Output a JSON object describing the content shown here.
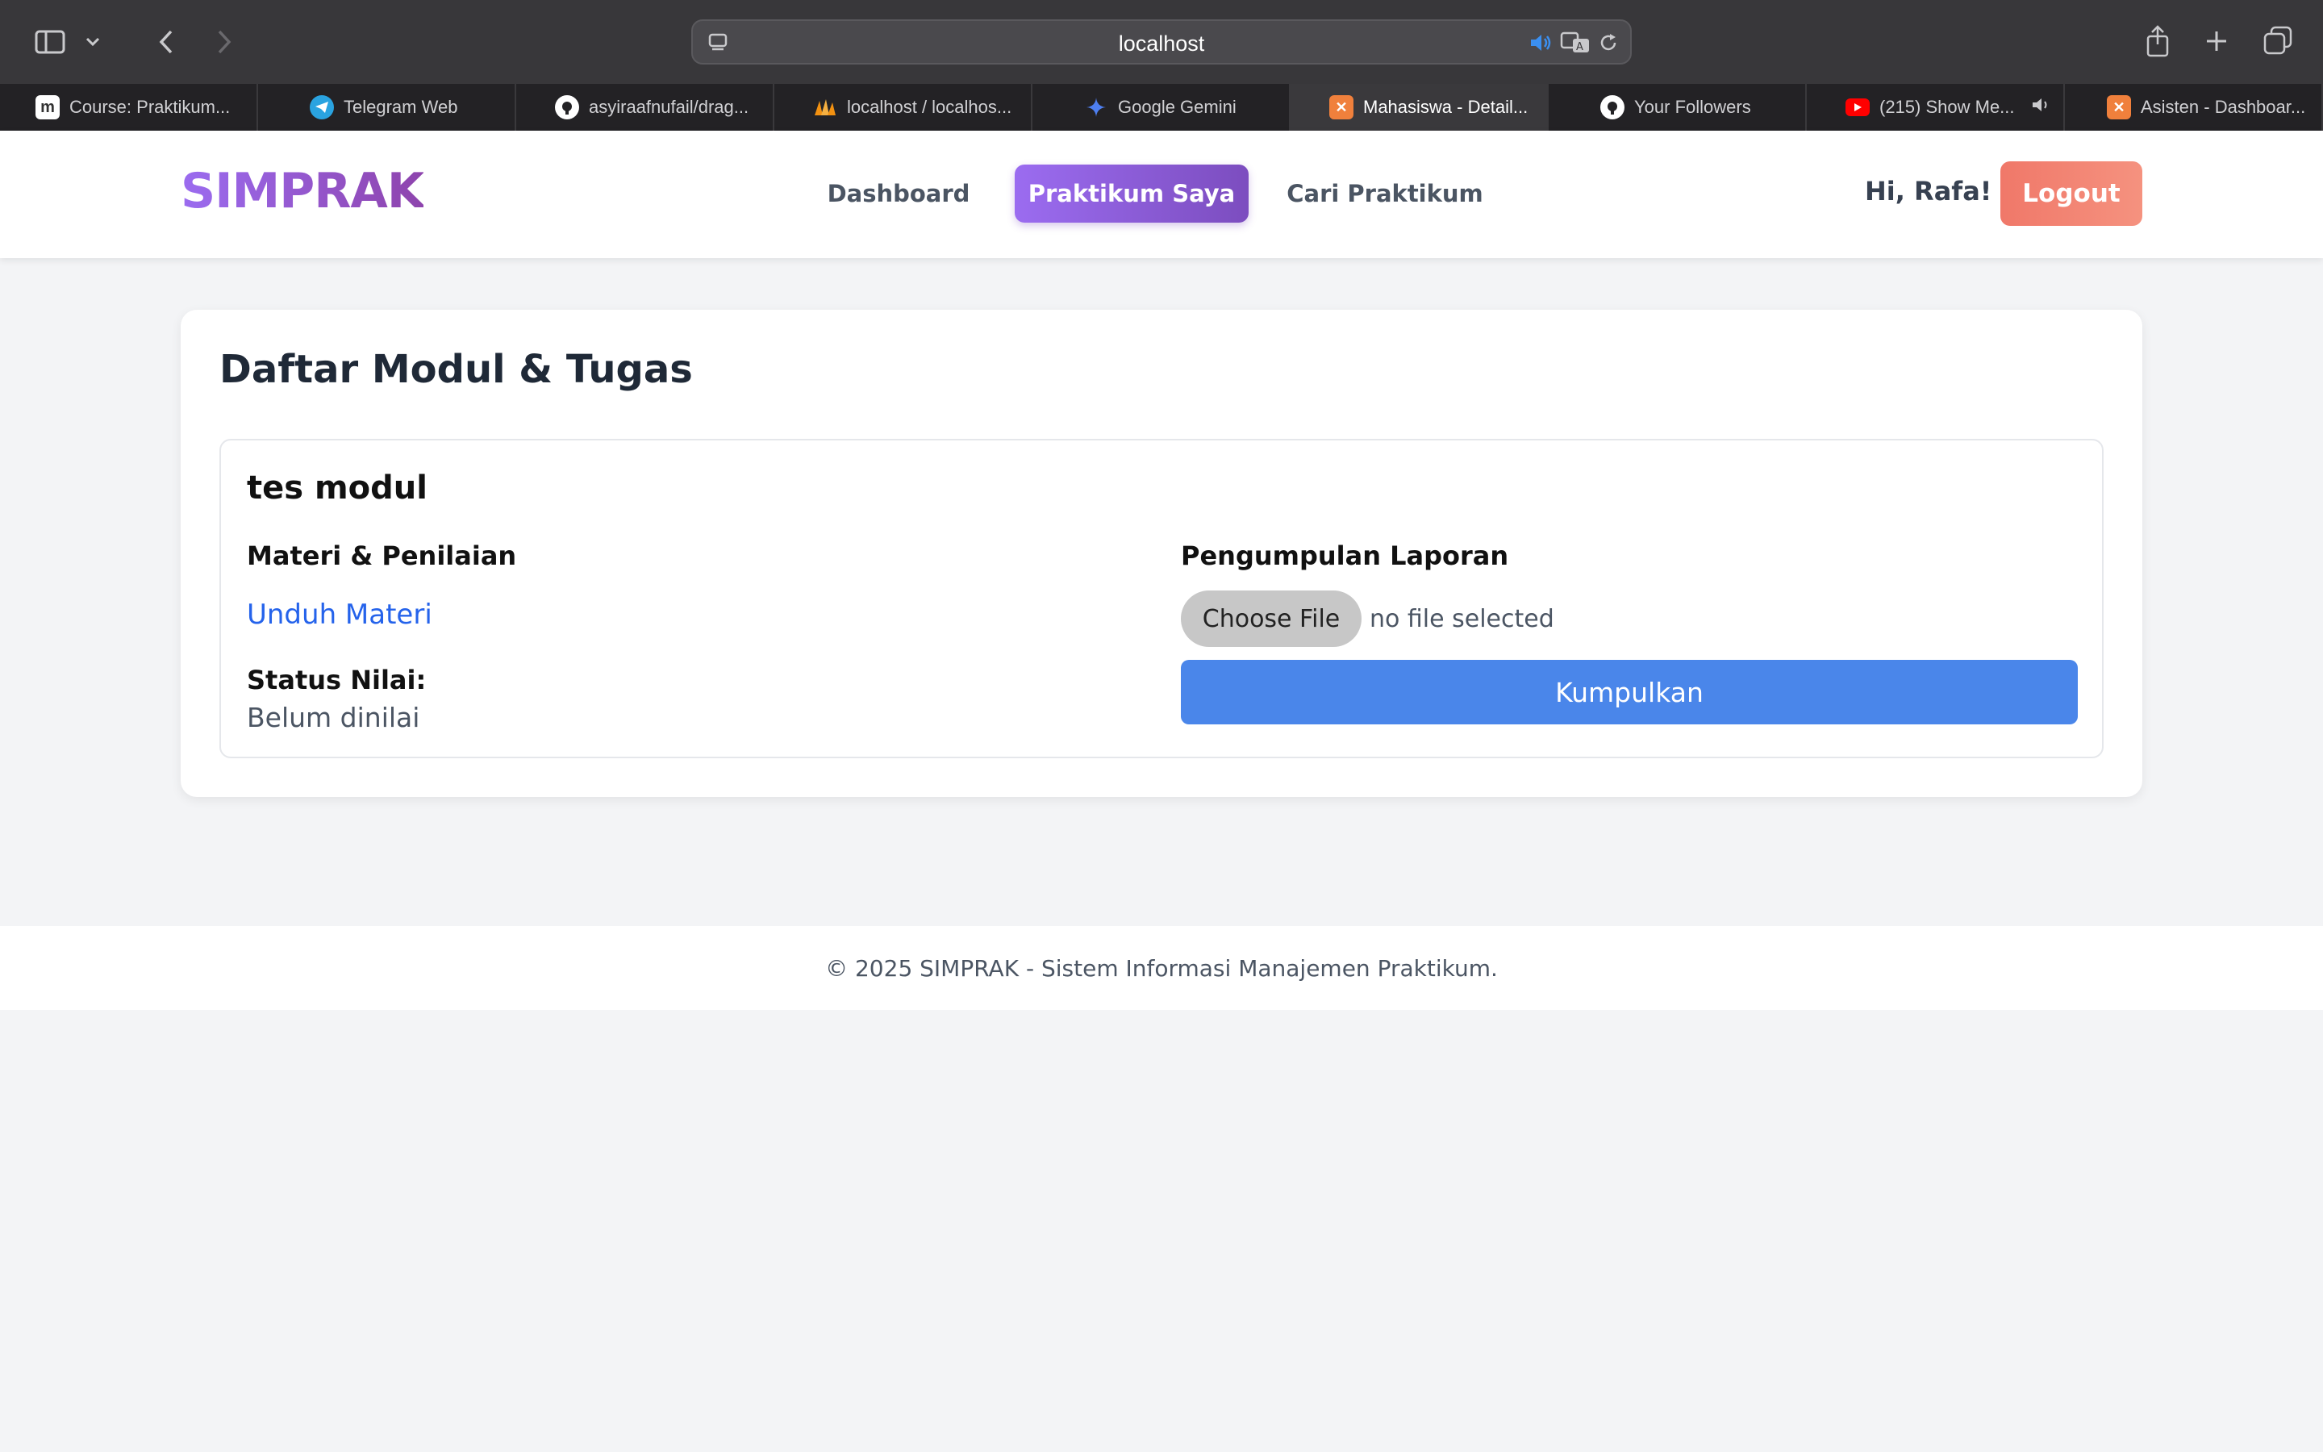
{
  "browser": {
    "url": "localhost",
    "tabs": [
      {
        "title": "Course: Praktikum...",
        "icon": "moodle-icon",
        "color": "#ffffff"
      },
      {
        "title": "Telegram Web",
        "icon": "telegram-icon",
        "color": "#2aa3e0"
      },
      {
        "title": "asyiraafnufail/drag...",
        "icon": "github-icon",
        "color": "#ffffff"
      },
      {
        "title": "localhost / localhos...",
        "icon": "phpmyadmin-icon",
        "color": "#f29111"
      },
      {
        "title": "Google Gemini",
        "icon": "gemini-icon",
        "color": "#4e7ff0"
      },
      {
        "title": "Mahasiswa - Detail...",
        "icon": "xampp-icon",
        "color": "#f0803c"
      },
      {
        "title": "Your Followers",
        "icon": "github-icon",
        "color": "#ffffff"
      },
      {
        "title": "(215) Show Me...",
        "icon": "youtube-icon",
        "color": "#ff0000"
      },
      {
        "title": "Asisten - Dashboar...",
        "icon": "xampp-icon",
        "color": "#f0803c"
      }
    ]
  },
  "header": {
    "brand": "SIMPRAK",
    "nav": {
      "dashboard": "Dashboard",
      "praktikum_saya": "Praktikum Saya",
      "cari_praktikum": "Cari Praktikum"
    },
    "greeting": "Hi, Rafa!",
    "logout": "Logout"
  },
  "main": {
    "title": "Daftar Modul & Tugas",
    "module": {
      "name": "tes modul",
      "materi_heading": "Materi & Penilaian",
      "download_link": "Unduh Materi",
      "status_label": "Status Nilai:",
      "status_value": "Belum dinilai",
      "submission_heading": "Pengumpulan Laporan",
      "choose_file": "Choose File",
      "no_file": "no file selected",
      "submit": "Kumpulkan"
    }
  },
  "footer": {
    "text": "© 2025 SIMPRAK - Sistem Informasi Manajemen Praktikum."
  },
  "colors": {
    "brand": "#8b5cf6",
    "nav_active": "#7c4dbf",
    "logout": "#f07869",
    "link": "#2563eb",
    "submit": "#4a86ea"
  }
}
